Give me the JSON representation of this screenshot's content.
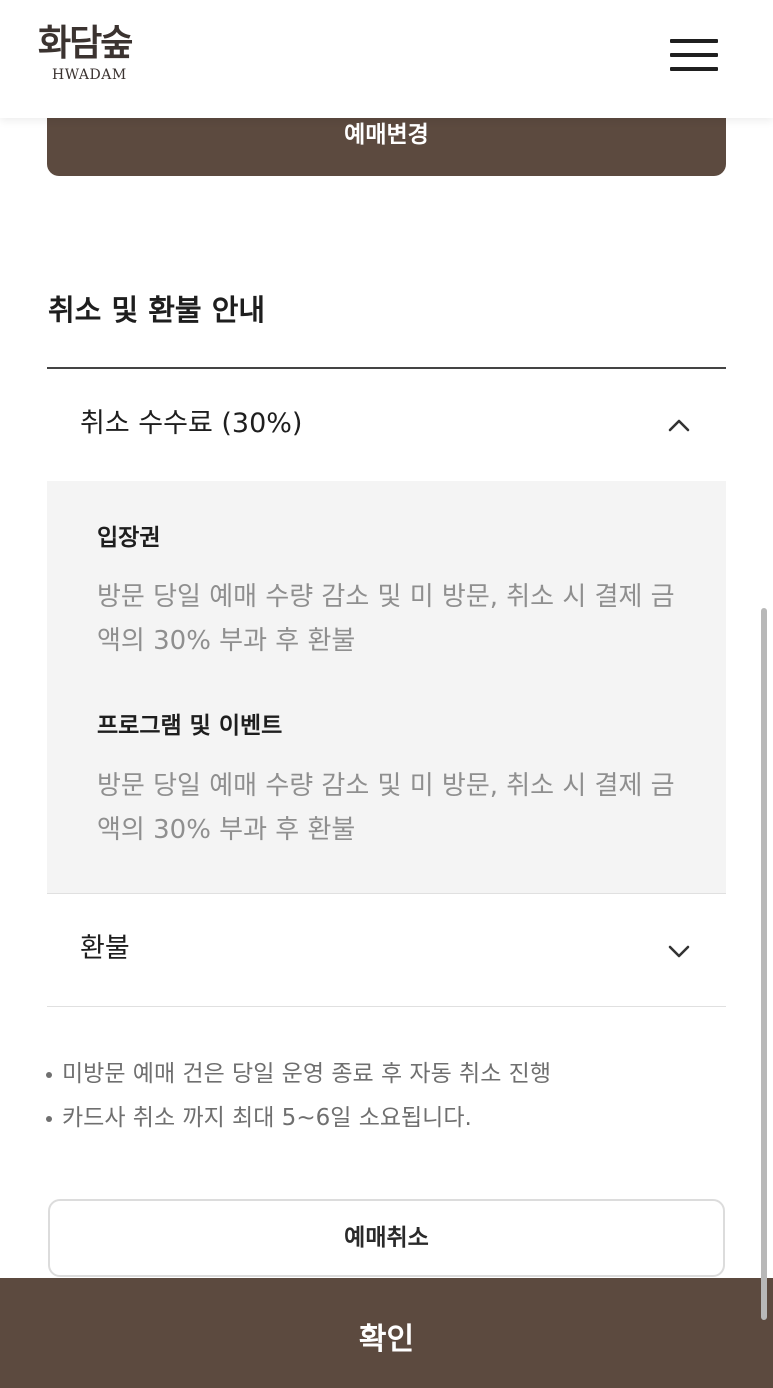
{
  "header": {
    "logo_kr": "화담숲",
    "logo_en": "HWADAM",
    "menu_icon": "hamburger-menu-icon"
  },
  "booking": {
    "change_label": "예매변경"
  },
  "refund_info": {
    "title": "취소 및 환불 안내",
    "fee_section": {
      "title": "취소 수수료 (30%)",
      "expanded": true,
      "icon": "chevron-up-icon",
      "items": [
        {
          "subtitle": "입장권",
          "text": "방문 당일 예매 수량 감소 및 미 방문, 취소 시 결제 금액의 30% 부과 후 환불"
        },
        {
          "subtitle": "프로그램 및 이벤트",
          "text": "방문 당일 예매 수량 감소 및 미 방문, 취소 시 결제 금액의 30% 부과 후 환불"
        }
      ]
    },
    "refund_section": {
      "title": "환불",
      "expanded": false,
      "icon": "chevron-down-icon"
    },
    "notes": [
      "미방문 예매 건은 당일 운영 종료 후 자동 취소 진행",
      "카드사 취소 까지 최대 5~6일 소요됩니다."
    ]
  },
  "actions": {
    "cancel_label": "예매취소",
    "confirm_label": "확인"
  },
  "colors": {
    "brand_brown": "#5c4a3f",
    "panel_bg": "#f4f4f4",
    "muted_text": "#8f8f8f"
  }
}
